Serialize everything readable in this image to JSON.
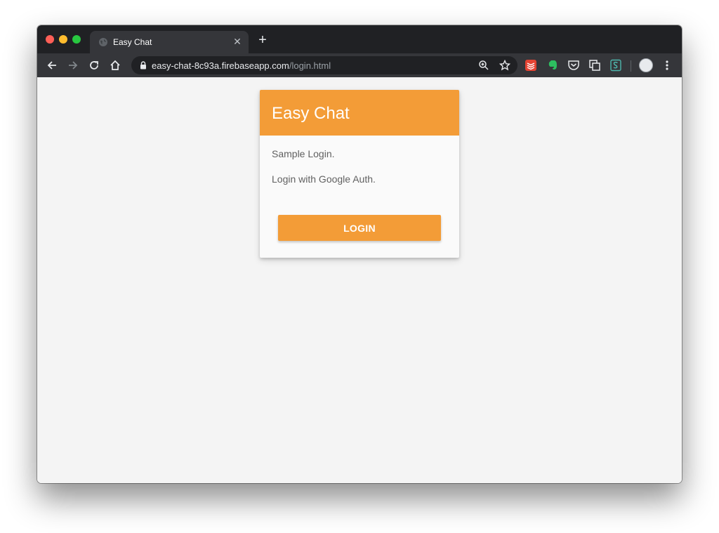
{
  "browser": {
    "tab": {
      "title": "Easy Chat",
      "close_glyph": "✕",
      "favicon": "globe-icon"
    },
    "new_tab_glyph": "+",
    "url_host": "easy-chat-8c93a.firebaseapp.com",
    "url_path": "/login.html"
  },
  "page": {
    "card_title": "Easy Chat",
    "line1": "Sample Login.",
    "line2": "Login with Google Auth.",
    "login_label": "LOGIN"
  },
  "colors": {
    "accent": "#f39c37",
    "chrome_dark": "#202124",
    "chrome_toolbar": "#35363a",
    "page_bg": "#f4f4f4"
  }
}
